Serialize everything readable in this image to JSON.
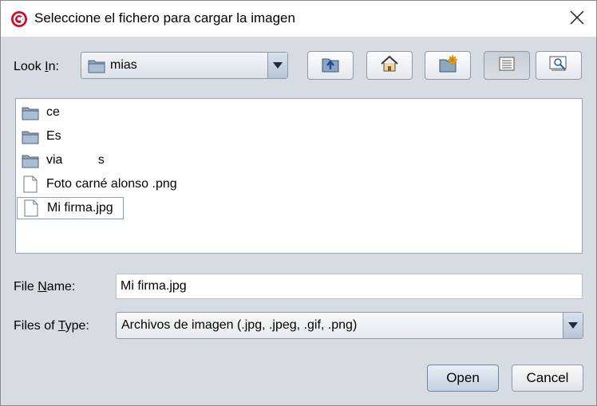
{
  "dialog": {
    "title": "Seleccione el fichero para cargar la imagen",
    "app_icon": "autofirma-logo-icon",
    "close_icon": "close-icon"
  },
  "look_in": {
    "label_pre": "Look ",
    "label_mnemonic": "I",
    "label_post": "n:",
    "selected": "mias",
    "icon": "folder-icon"
  },
  "toolbar": [
    {
      "name": "up-one-level-button",
      "icon": "folder-up-icon"
    },
    {
      "name": "home-button",
      "icon": "home-icon"
    },
    {
      "name": "new-folder-button",
      "icon": "new-folder-icon"
    },
    {
      "name": "list-view-button",
      "icon": "list-view-icon",
      "pressed": true
    },
    {
      "name": "details-view-button",
      "icon": "details-view-icon"
    }
  ],
  "files": [
    {
      "name": "ce",
      "type": "folder"
    },
    {
      "name": "Es",
      "type": "folder"
    },
    {
      "name": "via          s",
      "type": "folder"
    },
    {
      "name": "Foto carné alonso .png",
      "type": "file"
    },
    {
      "name": "Mi firma.jpg",
      "type": "file",
      "selected": true
    }
  ],
  "file_name": {
    "label_pre": "File ",
    "label_mnemonic": "N",
    "label_post": "ame:",
    "value": "Mi firma.jpg"
  },
  "files_of_type": {
    "label_pre": "Files of ",
    "label_mnemonic": "T",
    "label_post": "ype:",
    "selected": "Archivos de imagen (.jpg, .jpeg, .gif, .png)"
  },
  "buttons": {
    "open": "Open",
    "cancel": "Cancel"
  },
  "colors": {
    "dialog_bg": "#d7dbe2",
    "accent": "#c8102e",
    "folder": "#8fa6c0"
  }
}
